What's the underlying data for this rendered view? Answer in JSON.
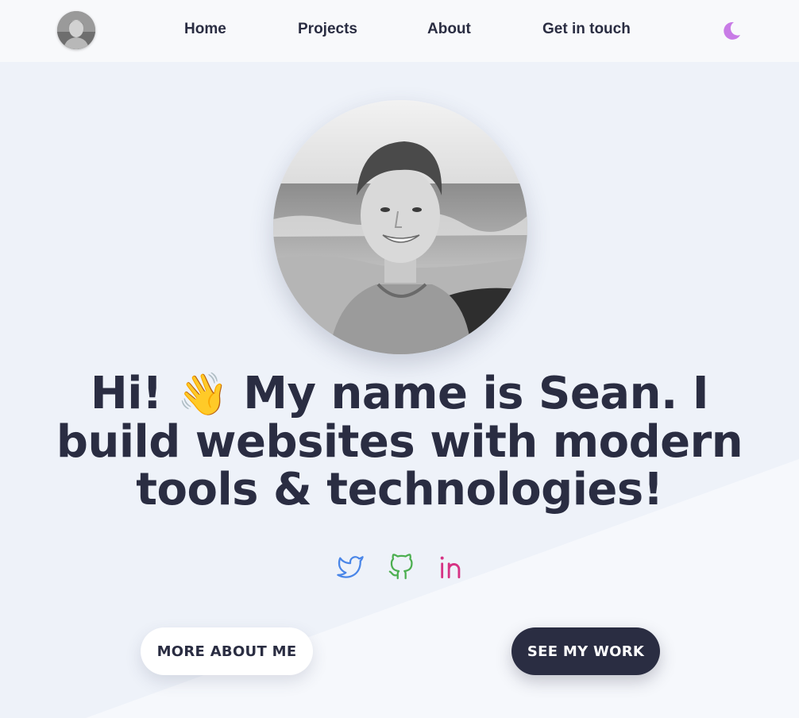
{
  "nav": {
    "avatar_alt": "Sean profile photo",
    "links": [
      {
        "label": "Home"
      },
      {
        "label": "Projects"
      },
      {
        "label": "About"
      },
      {
        "label": "Get in touch"
      }
    ],
    "theme_toggle_icon": "moon-icon"
  },
  "hero": {
    "photo_alt": "Sean smiling at the beach",
    "headline_part1": "Hi! ",
    "headline_emoji": "👋",
    "headline_part2": " My name is Sean. I build websites with modern tools & technologies!"
  },
  "social": [
    {
      "icon": "twitter-icon",
      "color": "#4a86e8"
    },
    {
      "icon": "github-icon",
      "color": "#4caf50"
    },
    {
      "icon": "linkedin-icon",
      "color": "#d63384"
    }
  ],
  "buttons": {
    "about_label": "MORE ABOUT ME",
    "work_label": "SEE MY WORK"
  },
  "colors": {
    "background": "#eef2f9",
    "text": "#2a2d42",
    "accent_moon": "#c87be6",
    "primary_button": "#2a2d42"
  }
}
